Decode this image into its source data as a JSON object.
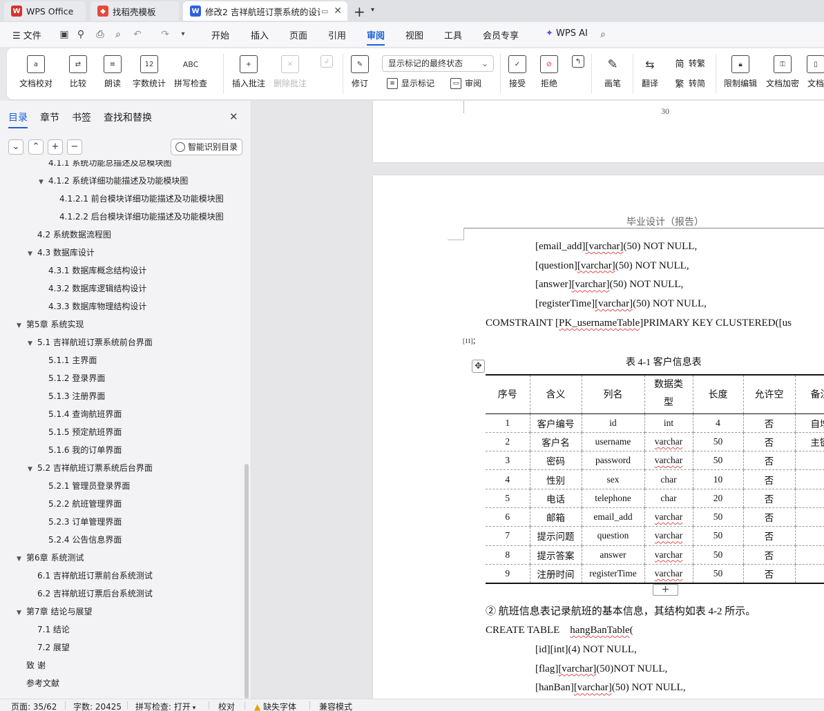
{
  "tabs": [
    {
      "label": "WPS Office",
      "icon": "wps-logo-icon",
      "color": "#d8322e"
    },
    {
      "label": "找稻壳模板",
      "icon": "docer-icon",
      "color": "#e5493a"
    },
    {
      "label": "修改2 吉祥航班订票系统的设计",
      "icon": "word-doc-icon",
      "color": "#2f62e0"
    }
  ],
  "menu": {
    "file": "文件",
    "items": [
      "开始",
      "插入",
      "页面",
      "引用",
      "审阅",
      "视图",
      "工具",
      "会员专享"
    ],
    "active": "审阅",
    "wps_ai": "WPS AI"
  },
  "ribbon": {
    "doc_proof": "文档校对",
    "compare": "比较",
    "read_aloud": "朗读",
    "word_count": "字数统计",
    "spell_check": "拼写检查",
    "insert_comment": "插入批注",
    "delete_comment": "删除批注",
    "track_changes": "修订",
    "final_state": "显示标记的最终状态",
    "show_markup": "显示标记",
    "review": "审阅",
    "accept": "接受",
    "reject": "拒绝",
    "ink": "画笔",
    "translate": "翻译",
    "to_traditional": "转繁",
    "to_simplified": "转简",
    "restrict_edit": "限制编辑",
    "encrypt": "文档加密",
    "doc_more": "文档"
  },
  "nav": {
    "tabs": [
      "目录",
      "章节",
      "书签",
      "查找和替换"
    ],
    "active": "目录",
    "smart_btn": "智能识别目录",
    "toc": [
      {
        "text": "4.1.1  系统功能总描述及总模块图",
        "level": 2,
        "exp": ""
      },
      {
        "text": "4.1.2  系统详细功能描述及功能模块图",
        "level": 2,
        "exp": "▼"
      },
      {
        "text": "4.1.2.1  前台模块详细功能描述及功能模块图",
        "level": 3,
        "exp": ""
      },
      {
        "text": "4.1.2.2  后台模块详细功能描述及功能模块图",
        "level": 3,
        "exp": ""
      },
      {
        "text": "4.2  系统数据流程图",
        "level": 1,
        "exp": ""
      },
      {
        "text": "4.3  数据库设计",
        "level": 1,
        "exp": "▼"
      },
      {
        "text": "4.3.1 数据库概念结构设计",
        "level": 2,
        "exp": ""
      },
      {
        "text": "4.3.2  数据库逻辑结构设计",
        "level": 2,
        "exp": ""
      },
      {
        "text": "4.3.3  数据库物理结构设计",
        "level": 2,
        "exp": ""
      },
      {
        "text": "第5章  系统实现",
        "level": 0,
        "exp": "▼"
      },
      {
        "text": "5.1  吉祥航班订票系统前台界面",
        "level": 1,
        "exp": "▼"
      },
      {
        "text": "5.1.1  主界面",
        "level": 2,
        "exp": ""
      },
      {
        "text": "5.1.2  登录界面",
        "level": 2,
        "exp": ""
      },
      {
        "text": "5.1.3  注册界面",
        "level": 2,
        "exp": ""
      },
      {
        "text": "5.1.4  查询航班界面",
        "level": 2,
        "exp": ""
      },
      {
        "text": "5.1.5  预定航班界面",
        "level": 2,
        "exp": ""
      },
      {
        "text": "5.1.6  我的订单界面",
        "level": 2,
        "exp": ""
      },
      {
        "text": "5.2  吉祥航班订票系统后台界面",
        "level": 1,
        "exp": "▼"
      },
      {
        "text": "5.2.1  管理员登录界面",
        "level": 2,
        "exp": ""
      },
      {
        "text": "5.2.2  航班管理界面",
        "level": 2,
        "exp": ""
      },
      {
        "text": "5.2.3  订单管理界面",
        "level": 2,
        "exp": ""
      },
      {
        "text": "5.2.4 公告信息界面",
        "level": 2,
        "exp": ""
      },
      {
        "text": "第6章  系统测试",
        "level": 0,
        "exp": "▼"
      },
      {
        "text": "6.1  吉祥航班订票前台系统测试",
        "level": 1,
        "exp": ""
      },
      {
        "text": "6.2  吉祥航班订票后台系统测试",
        "level": 1,
        "exp": ""
      },
      {
        "text": "第7章  结论与展望",
        "level": 0,
        "exp": "▼"
      },
      {
        "text": "7.1  结论",
        "level": 1,
        "exp": ""
      },
      {
        "text": "7.2  展望",
        "level": 1,
        "exp": ""
      },
      {
        "text": "致    谢",
        "level": 0,
        "exp": ""
      },
      {
        "text": "参考文献",
        "level": 0,
        "exp": ""
      }
    ]
  },
  "doc": {
    "prev_page_number": "30",
    "header": "毕业设计（报告）",
    "sql_lines_1": [
      [
        "[email_add]",
        "[varchar]",
        "(50) NOT NULL,"
      ],
      [
        "[question]",
        "[varchar]",
        "(50) NOT NULL,"
      ],
      [
        "[answer]",
        "[varchar]",
        "(50) NOT NULL,"
      ],
      [
        "[registerTime]",
        "[varchar]",
        "(50) NOT NULL,"
      ]
    ],
    "constraint_a": "COMSTRAINT  [",
    "constraint_b": "PK_usernameTable",
    "constraint_c": "]PRIMARY  KEY  CLUSTERED([us",
    "footnote_ref": "[11]",
    "footnote_tail": ";",
    "table_caption": "表 4-1  客户信息表",
    "table_headers": [
      "序号",
      "含义",
      "列名",
      "数据类型",
      "长度",
      "允许空",
      "备注"
    ],
    "table_rows": [
      [
        "1",
        "客户编号",
        "id",
        "int",
        "4",
        "否",
        "自增"
      ],
      [
        "2",
        "客户名",
        "username",
        "varchar",
        "50",
        "否",
        "主键"
      ],
      [
        "3",
        "密码",
        "password",
        "varchar",
        "50",
        "否",
        ""
      ],
      [
        "4",
        "性别",
        "sex",
        "char",
        "10",
        "否",
        ""
      ],
      [
        "5",
        "电话",
        "telephone",
        "char",
        "20",
        "否",
        ""
      ],
      [
        "6",
        "邮箱",
        "email_add",
        "varchar",
        "50",
        "否",
        ""
      ],
      [
        "7",
        "提示问题",
        "question",
        "varchar",
        "50",
        "否",
        ""
      ],
      [
        "8",
        "提示答案",
        "answer",
        "varchar",
        "50",
        "否",
        ""
      ],
      [
        "9",
        "注册时间",
        "registerTime",
        "varchar",
        "50",
        "否",
        ""
      ]
    ],
    "add_row": "+",
    "para": "② 航班信息表记录航班的基本信息，其结构如表 4-2 所示。",
    "create_a": "CREATE TABLE    ",
    "create_b": "hangBanTable",
    "create_c": "(",
    "sql_lines_2": [
      [
        "[id][int]",
        "",
        "(4) NOT NULL,"
      ],
      [
        "[flag]",
        "[varchar]",
        "(50)NOT NULL,"
      ],
      [
        "[hanBan]",
        "[varchar]",
        "(50) NOT NULL,"
      ]
    ]
  },
  "status": {
    "page": "页面: 35/62",
    "words": "字数: 20425",
    "spell": "拼写检查: 打开",
    "proof": "校对",
    "missing_font": "缺失字体",
    "compat": "兼容模式"
  }
}
